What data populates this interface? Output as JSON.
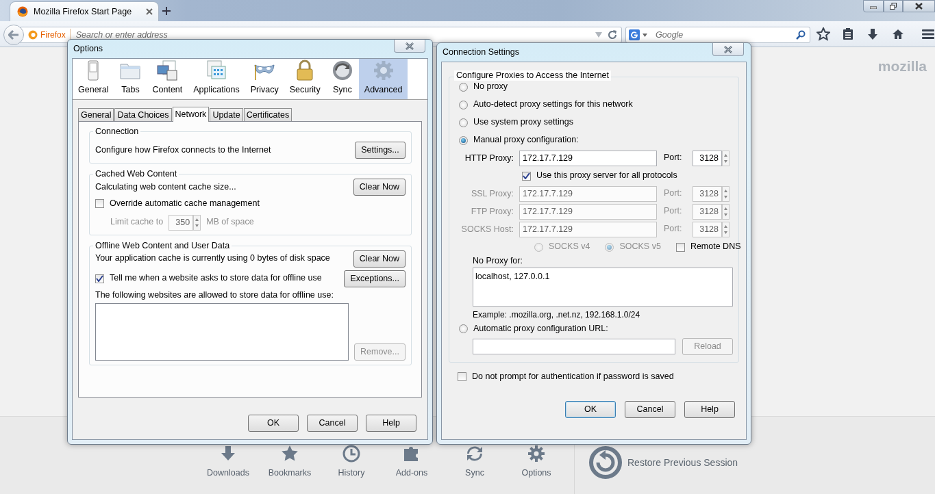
{
  "browser": {
    "tab": {
      "title": "Mozilla Firefox Start Page",
      "selected": true
    },
    "identity": "Firefox",
    "address": {
      "placeholder": "Search or enter address"
    },
    "search": {
      "placeholder": "Google"
    },
    "brand": "mozilla"
  },
  "launcher": {
    "items": [
      {
        "label": "Downloads",
        "kind": "download"
      },
      {
        "label": "Bookmarks",
        "kind": "star"
      },
      {
        "label": "History",
        "kind": "clock"
      },
      {
        "label": "Add-ons",
        "kind": "puzzle"
      },
      {
        "label": "Sync",
        "kind": "sync"
      },
      {
        "label": "Options",
        "kind": "gear"
      }
    ],
    "restore": "Restore Previous Session"
  },
  "options": {
    "title": "Options",
    "categories": [
      {
        "label": "General",
        "kind": "general",
        "selected": false
      },
      {
        "label": "Tabs",
        "kind": "tabs",
        "selected": false
      },
      {
        "label": "Content",
        "kind": "content",
        "selected": false
      },
      {
        "label": "Applications",
        "kind": "applications",
        "selected": false
      },
      {
        "label": "Privacy",
        "kind": "privacy",
        "selected": false
      },
      {
        "label": "Security",
        "kind": "security",
        "selected": false
      },
      {
        "label": "Sync",
        "kind": "sync",
        "selected": false
      },
      {
        "label": "Advanced",
        "kind": "advanced",
        "selected": true
      }
    ],
    "tabs": [
      {
        "label": "General",
        "selected": false
      },
      {
        "label": "Data Choices",
        "selected": false
      },
      {
        "label": "Network",
        "selected": true
      },
      {
        "label": "Update",
        "selected": false
      },
      {
        "label": "Certificates",
        "selected": false
      }
    ],
    "connection": {
      "legend": "Connection",
      "text": "Configure how Firefox connects to the Internet",
      "button": "Settings..."
    },
    "cache": {
      "legend": "Cached Web Content",
      "text": "Calculating web content cache size...",
      "button": "Clear Now",
      "override": {
        "label": "Override automatic cache management",
        "checked": false
      },
      "limit": {
        "label": "Limit cache to",
        "value": "350",
        "unit": "MB of space",
        "disabled": true
      }
    },
    "offline": {
      "legend": "Offline Web Content and User Data",
      "text": "Your application cache is currently using 0 bytes of disk space",
      "button": "Clear Now",
      "notify": {
        "label": "Tell me when a website asks to store data for offline use",
        "checked": true
      },
      "exceptions": "Exceptions...",
      "list_label": "The following websites are allowed to store data for offline use:",
      "remove": {
        "label": "Remove...",
        "disabled": true
      }
    },
    "buttons": [
      {
        "label": "OK",
        "default": false
      },
      {
        "label": "Cancel",
        "default": false
      },
      {
        "label": "Help",
        "default": false
      }
    ]
  },
  "connection_settings": {
    "title": "Connection Settings",
    "legend": "Configure Proxies to Access the Internet",
    "modes": [
      {
        "label": "No proxy",
        "selected": false
      },
      {
        "label": "Auto-detect proxy settings for this network",
        "selected": false
      },
      {
        "label": "Use system proxy settings",
        "selected": false
      },
      {
        "label": "Manual proxy configuration:",
        "selected": true
      }
    ],
    "proxies": [
      {
        "label": "HTTP Proxy:",
        "value": "172.17.7.129",
        "port_label": "Port:",
        "port": "3128",
        "disabled": false
      },
      {
        "label": "SSL Proxy:",
        "value": "172.17.7.129",
        "port_label": "Port:",
        "port": "3128",
        "disabled": true
      },
      {
        "label": "FTP Proxy:",
        "value": "172.17.7.129",
        "port_label": "Port:",
        "port": "3128",
        "disabled": true
      },
      {
        "label": "SOCKS Host:",
        "value": "172.17.7.129",
        "port_label": "Port:",
        "port": "3128",
        "disabled": true
      }
    ],
    "share": {
      "label": "Use this proxy server for all protocols",
      "checked": true
    },
    "socks_versions": [
      {
        "label": "SOCKS v4",
        "selected": false,
        "disabled": true
      },
      {
        "label": "SOCKS v5",
        "selected": true,
        "disabled": true
      }
    ],
    "remote_dns": {
      "label": "Remote DNS",
      "checked": false
    },
    "no_proxy": {
      "label": "No Proxy for:",
      "value": "localhost, 127.0.0.1",
      "example": "Example: .mozilla.org, .net.nz, 192.168.1.0/24"
    },
    "auto_config": {
      "label": "Automatic proxy configuration URL:",
      "selected": false,
      "button": "Reload",
      "disabled": true
    },
    "no_prompt": {
      "label": "Do not prompt for authentication if password is saved",
      "checked": false
    },
    "buttons": [
      {
        "label": "OK",
        "default": true
      },
      {
        "label": "Cancel",
        "default": false
      },
      {
        "label": "Help",
        "default": false
      }
    ]
  }
}
